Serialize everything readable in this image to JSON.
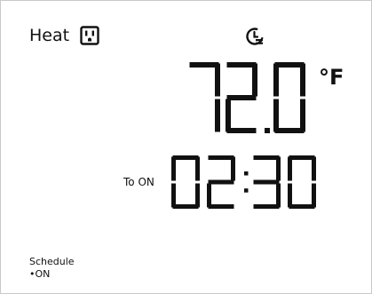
{
  "display": {
    "mode_label": "Heat",
    "mode_icon": "power-outlet-icon",
    "schedule_icon": "clock-schedule-icon",
    "temperature": {
      "value": "72.0",
      "unit": "°F"
    },
    "timer": {
      "label": "To ON",
      "value": "02:30"
    },
    "schedule": {
      "title": "Schedule",
      "status": "•ON"
    }
  },
  "colors": {
    "segment": "#111111",
    "background": "#ffffff",
    "border": "#c9c9c9"
  }
}
